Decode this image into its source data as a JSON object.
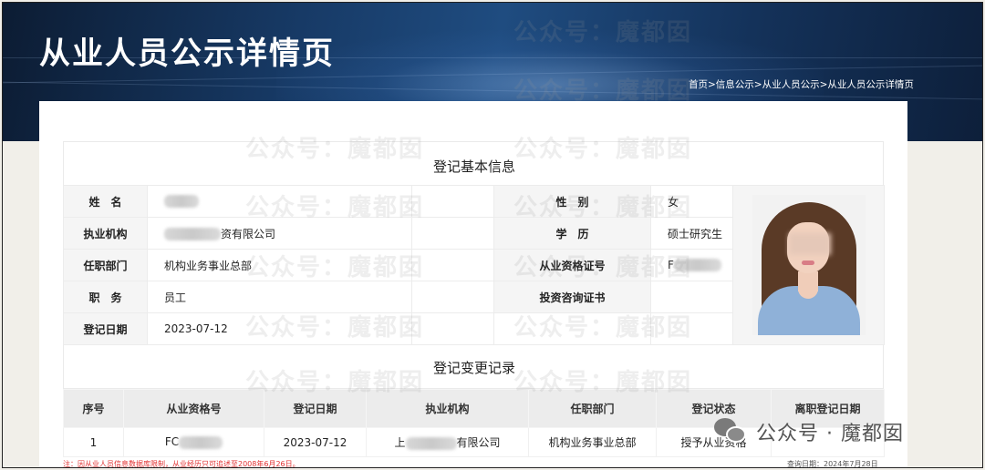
{
  "header": {
    "title": "从业人员公示详情页",
    "breadcrumb": "首页>信息公示>从业人员公示>从业人员公示详情页"
  },
  "basic_info": {
    "title": "登记基本信息",
    "name_label": "姓　名",
    "name_value": "",
    "gender_label": "性　别",
    "gender_value": "女",
    "org_label": "执业机构",
    "org_value": "资有限公司",
    "education_label": "学　历",
    "education_value": "硕士研究生",
    "dept_label": "任职部门",
    "dept_value": "机构业务事业总部",
    "cert_label": "从业资格证号",
    "cert_value": "F",
    "position_label": "职　务",
    "position_value": "员工",
    "advisor_cert_label": "投资咨询证书",
    "advisor_cert_value": "",
    "reg_date_label": "登记日期",
    "reg_date_value": "2023-07-12"
  },
  "change_records": {
    "title": "登记变更记录",
    "columns": [
      "序号",
      "从业资格号",
      "登记日期",
      "执业机构",
      "任职部门",
      "登记状态",
      "离职登记日期"
    ],
    "rows": [
      {
        "index": "1",
        "cert": "FC",
        "date": "2023-07-12",
        "org_prefix": "上",
        "org_suffix": "有限公司",
        "dept": "机构业务事业总部",
        "status": "授予从业资格",
        "leave_date": ""
      }
    ]
  },
  "footer": {
    "notice": "注：因从业人员信息数据库限制，从业经历只可追述至2008年6月26日。",
    "query_date": "查询日期：2024年7月28日"
  },
  "watermark": {
    "badge_text": "公众号 · 魔都囡",
    "tile_text": "公众号：魔都囡"
  }
}
